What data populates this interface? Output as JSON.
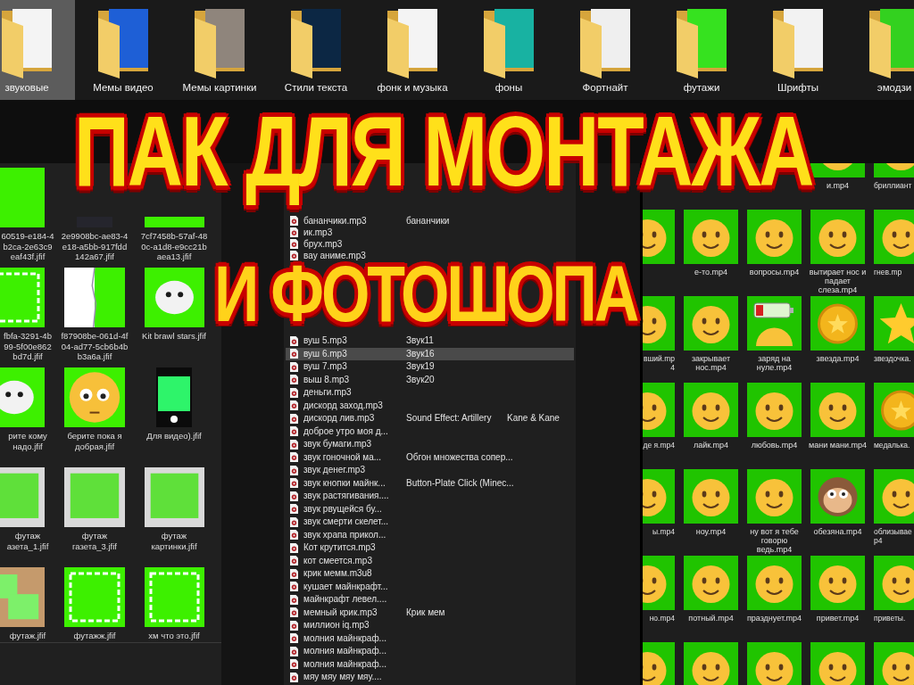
{
  "folder_bar": {
    "folders": [
      {
        "label": "звуковые",
        "selected": true
      },
      {
        "label": "Мемы видео",
        "selected": false
      },
      {
        "label": "Мемы картинки",
        "selected": false
      },
      {
        "label": "Стили текста",
        "selected": false
      },
      {
        "label": "фонк и музыка",
        "selected": false
      },
      {
        "label": "фоны",
        "selected": false
      },
      {
        "label": "Фортнайт",
        "selected": false
      },
      {
        "label": "футажи",
        "selected": false
      },
      {
        "label": "Шрифты",
        "selected": false
      },
      {
        "label": "эмодзи",
        "selected": false
      }
    ]
  },
  "headline": [
    "ПАК ДЛЯ МОНТАЖА",
    "И ФОТОШОПА"
  ],
  "image_folder": {
    "rows": [
      [
        {
          "kind": "green",
          "label": "60519-e184-4 b2ca-2e63c9 eaf43f.jfif"
        },
        {
          "kind": "photo",
          "label": "2e9908bc-ae83-4 e18-a5bb-917fdd 142a67.jfif"
        },
        {
          "kind": "green",
          "label": "7cf7458b-57af-48 0c-a1d8-e9cc21b aea13.jfif"
        }
      ],
      [
        {
          "kind": "frame",
          "label": "fbfa-3291-4b 99-5f00e862 bd7d.jfif"
        },
        {
          "kind": "split",
          "label": "f87908be-061d-4f 04-ad77-5cb6b4b b3a6a.jfif"
        },
        {
          "kind": "sticker",
          "label": "Kit brawl stars.jfif"
        }
      ],
      [
        {
          "kind": "sticker",
          "label": "рите кому надо.jfif"
        },
        {
          "kind": "emoji",
          "label": "берите пока я добрая.jfif"
        },
        {
          "kind": "phone",
          "label": "Для видео).jfif"
        }
      ],
      [
        {
          "kind": "paper",
          "label": "футаж азета_1.jfif"
        },
        {
          "kind": "paper",
          "label": "футаж газета_3.jfif"
        },
        {
          "kind": "paper",
          "label": "футаж картинки.jfif"
        }
      ],
      [
        {
          "kind": "board",
          "label": "футаж.jfif"
        },
        {
          "kind": "frame",
          "label": "футажж.jfif"
        },
        {
          "kind": "frame",
          "label": "хм что это.jfif"
        }
      ]
    ]
  },
  "sound_folder": {
    "upper_rows": [
      {
        "column_1": "бананчики.mp3",
        "column_2": "бананчики",
        "selected": false
      },
      {
        "column_1": "ик.mp3",
        "selected": false
      },
      {
        "column_1": "брух.mp3",
        "selected": false
      },
      {
        "column_1": "вау аниме.mp3",
        "selected": false
      }
    ],
    "lower_rows": [
      {
        "column_1": "вуш 5.mp3",
        "column_2": "Звук11",
        "selected": false
      },
      {
        "column_1": "вуш 6.mp3",
        "column_2": "Звук16",
        "selected": true
      },
      {
        "column_1": "вуш 7.mp3",
        "column_2": "Звук19",
        "selected": false
      },
      {
        "column_1": "выш 8.mp3",
        "column_2": "Звук20",
        "selected": false
      },
      {
        "column_1": "деньги.mp3",
        "selected": false
      },
      {
        "column_1": "дискорд заход.mp3",
        "selected": false
      },
      {
        "column_1": "дискорд лив.mp3",
        "column_2": "Sound Effect: Artillery",
        "column_3": "Kane & Kane",
        "selected": false
      },
      {
        "column_1": "доброе утро моя д...",
        "selected": false
      },
      {
        "column_1": "звук бумаги.mp3",
        "selected": false
      },
      {
        "column_1": "звук гоночной ма...",
        "column_2": "Обгон множества сопер...",
        "selected": false
      },
      {
        "column_1": "звук денег.mp3",
        "selected": false
      },
      {
        "column_1": "звук кнопки майнк...",
        "column_2": "Button-Plate Click (Minec...",
        "selected": false
      },
      {
        "column_1": "звук растягивания....",
        "selected": false
      },
      {
        "column_1": "звук рвущейся бу...",
        "selected": false
      },
      {
        "column_1": "звук смерти скелет...",
        "selected": false
      },
      {
        "column_1": "звук храпа прикол...",
        "selected": false
      },
      {
        "column_1": "Кот крутится.mp3",
        "selected": false
      },
      {
        "column_1": "кот смеется.mp3",
        "selected": false
      },
      {
        "column_1": "крик мемм.m3u8",
        "selected": false
      },
      {
        "column_1": "кушает майнкрафт...",
        "selected": false
      },
      {
        "column_1": "майнкрафт левел....",
        "selected": false
      },
      {
        "column_1": "мемный крик.mp3",
        "column_2": "Крик мем",
        "selected": false
      },
      {
        "column_1": "миллион iq.mp3",
        "selected": false
      },
      {
        "column_1": "молния майнкраф...",
        "selected": false
      },
      {
        "column_1": "молния майнкраф...",
        "selected": false
      },
      {
        "column_1": "молния майнкраф...",
        "selected": false
      },
      {
        "column_1": "мяу мяу мяу мяу....",
        "selected": false
      }
    ]
  },
  "emoji_folder": {
    "rows": [
      [
        "",
        "",
        "",
        {
          "kind": "face",
          "label": "и.mp4"
        },
        {
          "kind": "face",
          "label": "бриллиант"
        }
      ],
      [
        {
          "kind": "face"
        },
        {
          "kind": "face",
          "label": "е-то.mp4"
        },
        {
          "kind": "face",
          "label": "вопросы.mp4"
        },
        {
          "kind": "face",
          "label": "вытирает нос и падает слеза.mp4"
        },
        {
          "kind": "face",
          "label": "гнев.mp"
        }
      ],
      [
        {
          "kind": "face",
          "label": "вший.mp 4"
        },
        {
          "kind": "face",
          "label": "закрывает нос.mp4"
        },
        {
          "kind": "battery",
          "label": "заряд на нуле.mp4"
        },
        {
          "kind": "coin",
          "label": "звезда.mp4"
        },
        {
          "kind": "star",
          "label": "звездочка."
        }
      ],
      [
        {
          "kind": "face",
          "label": "де я.mp4"
        },
        {
          "kind": "face",
          "label": "лайк.mp4"
        },
        {
          "kind": "face",
          "label": "любовь.mp4"
        },
        {
          "kind": "face",
          "label": "мани мани.mp4"
        },
        {
          "kind": "coin",
          "label": "медалька."
        }
      ],
      [
        {
          "kind": "face",
          "label": "ы.mp4"
        },
        {
          "kind": "face",
          "label": "ноу.mp4"
        },
        {
          "kind": "face",
          "label": "ну вот я тебе говорю ведь.mp4"
        },
        {
          "kind": "monkey",
          "label": "обезяна.mp4"
        },
        {
          "kind": "face",
          "label": "облизывае р4"
        }
      ],
      [
        {
          "kind": "face",
          "label": "но.mp4"
        },
        {
          "kind": "face",
          "label": "потный.mp4"
        },
        {
          "kind": "face",
          "label": "празднует.mp4"
        },
        {
          "kind": "face",
          "label": "привет.mp4"
        },
        {
          "kind": "face",
          "label": "приветы."
        }
      ],
      [
        {
          "kind": "face"
        },
        {
          "kind": "face"
        },
        {
          "kind": "face"
        },
        {
          "kind": "face"
        },
        {
          "kind": "face"
        }
      ]
    ]
  }
}
